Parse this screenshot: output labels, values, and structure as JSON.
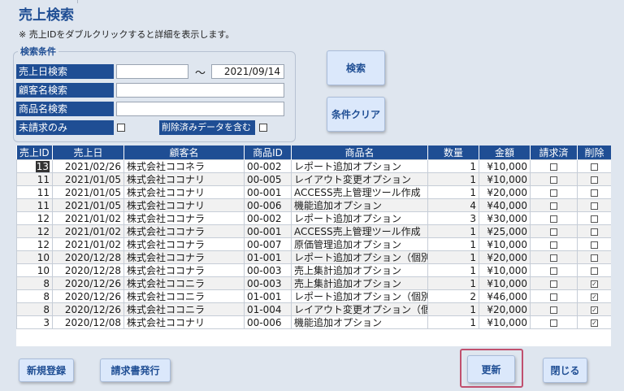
{
  "title": "売上検索",
  "note": "※ 売上IDをダブルクリックすると詳細を表示します。",
  "search": {
    "legend": "検索条件",
    "sale_date_label": "売上日検索",
    "date_from": "",
    "tilde": "～",
    "date_to": "2021/09/14",
    "customer_label": "顧客名検索",
    "customer_value": "",
    "product_label": "商品名検索",
    "product_value": "",
    "unbilled_label": "未請求のみ",
    "deleted_label": "削除済みデータを含む"
  },
  "buttons": {
    "search": "検索",
    "clear": "条件クリア",
    "new": "新規登録",
    "invoice": "請求書発行",
    "update": "更新",
    "close": "閉じる"
  },
  "table": {
    "headers": [
      "売上ID",
      "売上日",
      "顧客名",
      "商品ID",
      "商品名",
      "数量",
      "金額",
      "請求済",
      "削除"
    ],
    "rows": [
      {
        "id": "13",
        "date": "2021/02/26",
        "customer": "株式会社ココネラ",
        "pid": "00-002",
        "product": "レポート追加オプション",
        "qty": "1",
        "amount": "¥10,000",
        "billed": false,
        "deleted": false
      },
      {
        "id": "11",
        "date": "2021/01/05",
        "customer": "株式会社ココナリ",
        "pid": "00-005",
        "product": "レイアウト変更オプション",
        "qty": "1",
        "amount": "¥10,000",
        "billed": false,
        "deleted": false
      },
      {
        "id": "11",
        "date": "2021/01/05",
        "customer": "株式会社ココナリ",
        "pid": "00-001",
        "product": "ACCESS売上管理ツール作成",
        "qty": "1",
        "amount": "¥20,000",
        "billed": false,
        "deleted": false
      },
      {
        "id": "11",
        "date": "2021/01/05",
        "customer": "株式会社ココナリ",
        "pid": "00-006",
        "product": "機能追加オプション",
        "qty": "4",
        "amount": "¥40,000",
        "billed": false,
        "deleted": false
      },
      {
        "id": "12",
        "date": "2021/01/02",
        "customer": "株式会社ココナラ",
        "pid": "00-002",
        "product": "レポート追加オプション",
        "qty": "3",
        "amount": "¥30,000",
        "billed": false,
        "deleted": false
      },
      {
        "id": "12",
        "date": "2021/01/02",
        "customer": "株式会社ココナラ",
        "pid": "00-001",
        "product": "ACCESS売上管理ツール作成",
        "qty": "1",
        "amount": "¥25,000",
        "billed": false,
        "deleted": false
      },
      {
        "id": "12",
        "date": "2021/01/02",
        "customer": "株式会社ココナラ",
        "pid": "00-007",
        "product": "原価管理追加オプション",
        "qty": "1",
        "amount": "¥10,000",
        "billed": false,
        "deleted": false
      },
      {
        "id": "10",
        "date": "2020/12/28",
        "customer": "株式会社ココナラ",
        "pid": "01-001",
        "product": "レポート追加オプション（個別）",
        "qty": "1",
        "amount": "¥20,000",
        "billed": false,
        "deleted": false
      },
      {
        "id": "10",
        "date": "2020/12/28",
        "customer": "株式会社ココナラ",
        "pid": "00-003",
        "product": "売上集計追加オプション",
        "qty": "1",
        "amount": "¥10,000",
        "billed": false,
        "deleted": false
      },
      {
        "id": "8",
        "date": "2020/12/26",
        "customer": "株式会社ココニラ",
        "pid": "00-003",
        "product": "売上集計追加オプション",
        "qty": "1",
        "amount": "¥10,000",
        "billed": false,
        "deleted": true
      },
      {
        "id": "8",
        "date": "2020/12/26",
        "customer": "株式会社ココニラ",
        "pid": "01-001",
        "product": "レポート追加オプション（個別）",
        "qty": "2",
        "amount": "¥46,000",
        "billed": false,
        "deleted": true
      },
      {
        "id": "8",
        "date": "2020/12/26",
        "customer": "株式会社ココニラ",
        "pid": "01-004",
        "product": "レイアウト変更オプション（個別）",
        "qty": "1",
        "amount": "¥20,000",
        "billed": false,
        "deleted": true
      },
      {
        "id": "3",
        "date": "2020/12/08",
        "customer": "株式会社ココナリ",
        "pid": "00-006",
        "product": "機能追加オプション",
        "qty": "1",
        "amount": "¥10,000",
        "billed": false,
        "deleted": true
      }
    ]
  }
}
